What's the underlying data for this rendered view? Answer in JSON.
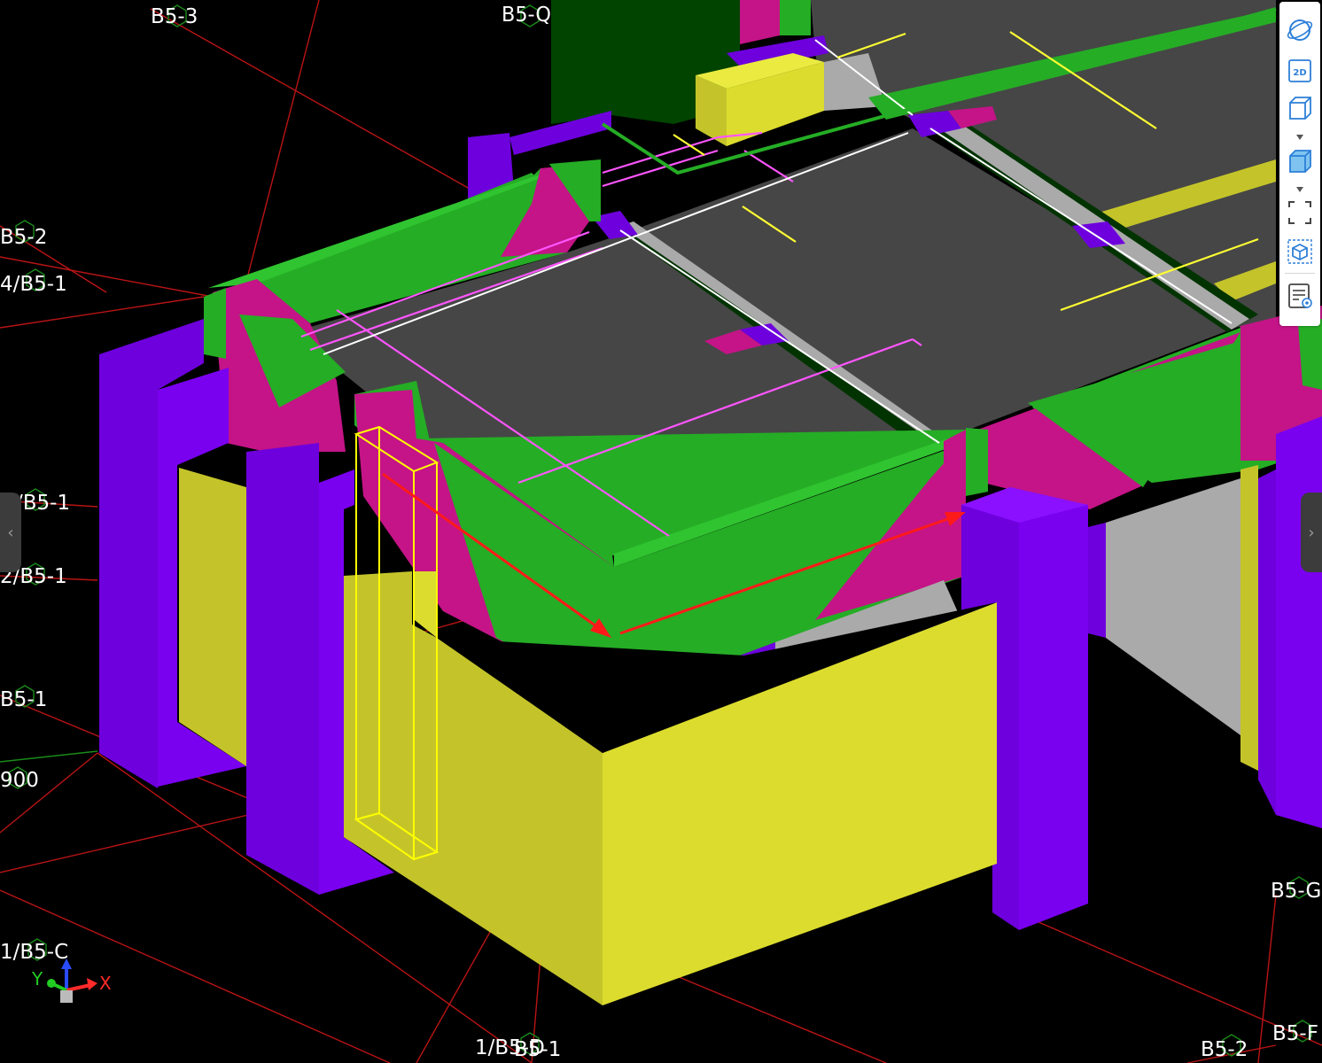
{
  "grid_labels": [
    {
      "id": "b5-3",
      "text": "B5-3"
    },
    {
      "id": "b5-q",
      "text": "B5-Q"
    },
    {
      "id": "b5-2-left",
      "text": "B5-2"
    },
    {
      "id": "b5-1-slash4",
      "text": "4/B5-1"
    },
    {
      "id": "b5-1-slash",
      "text": "/B5-1"
    },
    {
      "id": "b5-1-slash2",
      "text": "2/B5-1"
    },
    {
      "id": "b5-1-bottom",
      "text": "B5-1"
    },
    {
      "id": "elev-900",
      "text": "900"
    },
    {
      "id": "b5-c",
      "text": "1/B5-C"
    },
    {
      "id": "b5-d",
      "text": "1/B5-D"
    },
    {
      "id": "b5-d1",
      "text": "B5-1"
    },
    {
      "id": "b5-g",
      "text": "B5-G"
    },
    {
      "id": "b5-2-bottom",
      "text": "B5-2"
    },
    {
      "id": "b5-f",
      "text": "B5-F"
    }
  ],
  "axis_gizmo": {
    "x": "X",
    "y": "Y"
  },
  "toolbar": {
    "badge_2d": "2D",
    "tools": [
      {
        "id": "orbit",
        "icon": "orbit-icon"
      },
      {
        "id": "view-2d",
        "icon": "view-2d-icon"
      },
      {
        "id": "view-3d",
        "icon": "box-wireframe-icon"
      },
      {
        "id": "display-style",
        "icon": "box-shaded-icon"
      },
      {
        "id": "section-box",
        "icon": "section-box-icon"
      },
      {
        "id": "isolate",
        "icon": "isolate-cube-icon"
      },
      {
        "id": "properties",
        "icon": "properties-list-icon"
      }
    ]
  },
  "navigation": {
    "prev_glyph": "‹",
    "next_glyph": "›"
  },
  "colors": {
    "column": "#6e00dd",
    "wall": "#dcdc2e",
    "beam": "#25ad25",
    "beam_magenta": "#c41487",
    "slab": "#464646",
    "grid_line": "#b91414",
    "rebar": "#ff55ff",
    "selection": "#ffff00",
    "arrow": "#ff1a1a"
  }
}
